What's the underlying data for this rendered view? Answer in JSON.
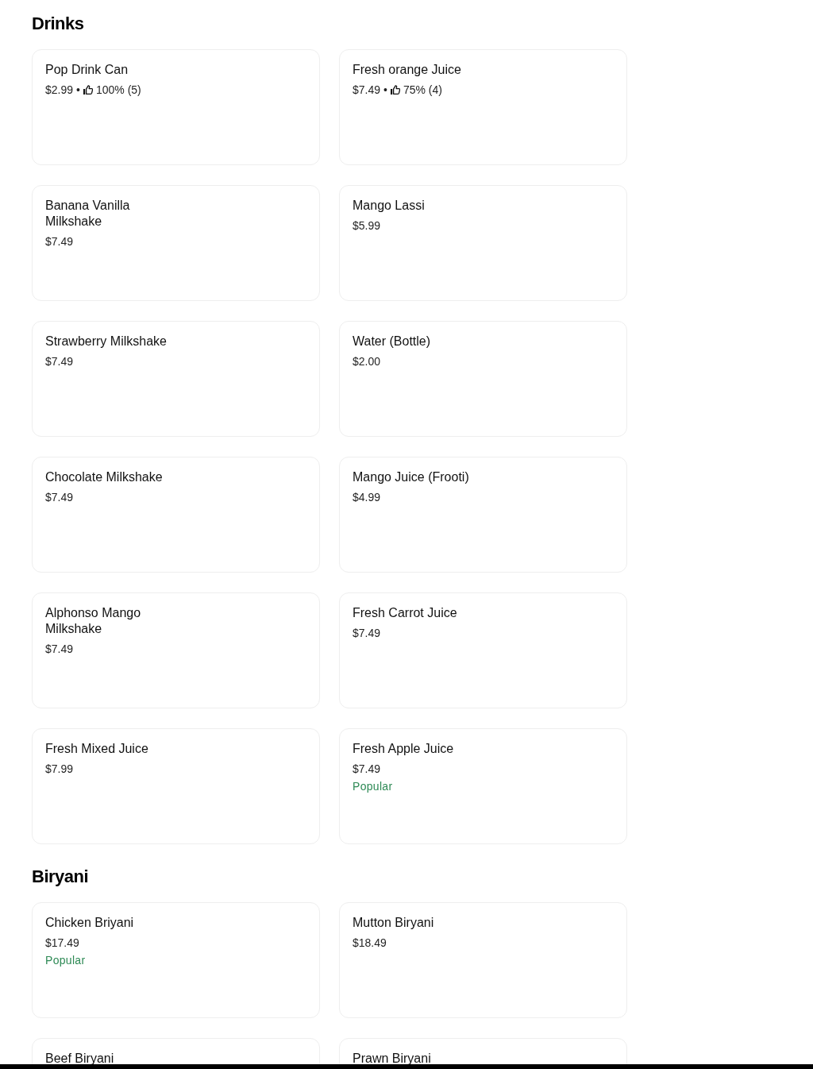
{
  "sections": [
    {
      "title": "Drinks",
      "items": [
        {
          "name": "Pop Drink Can",
          "price": "$2.99",
          "rating": {
            "separator": "•",
            "score": "100% (5)"
          }
        },
        {
          "name": "Fresh orange Juice",
          "price": "$7.49",
          "rating": {
            "separator": "•",
            "score": "75% (4)"
          }
        },
        {
          "name": "Banana Vanilla Milkshake",
          "price": "$7.49"
        },
        {
          "name": "Mango Lassi",
          "price": "$5.99"
        },
        {
          "name": "Strawberry Milkshake",
          "price": "$7.49"
        },
        {
          "name": "Water (Bottle)",
          "price": "$2.00"
        },
        {
          "name": "Chocolate Milkshake",
          "price": "$7.49"
        },
        {
          "name": "Mango Juice (Frooti)",
          "price": "$4.99"
        },
        {
          "name": "Alphonso Mango Milkshake",
          "price": "$7.49"
        },
        {
          "name": "Fresh Carrot Juice",
          "price": "$7.49"
        },
        {
          "name": "Fresh Mixed Juice",
          "price": "$7.99"
        },
        {
          "name": "Fresh Apple Juice",
          "price": "$7.49",
          "badge": "Popular"
        }
      ]
    },
    {
      "title": "Biryani",
      "items": [
        {
          "name": "Chicken Briyani",
          "price": "$17.49",
          "badge": "Popular"
        },
        {
          "name": "Mutton Biryani",
          "price": "$18.49"
        },
        {
          "name": "Beef Biryani"
        },
        {
          "name": "Prawn Biryani"
        }
      ]
    }
  ]
}
